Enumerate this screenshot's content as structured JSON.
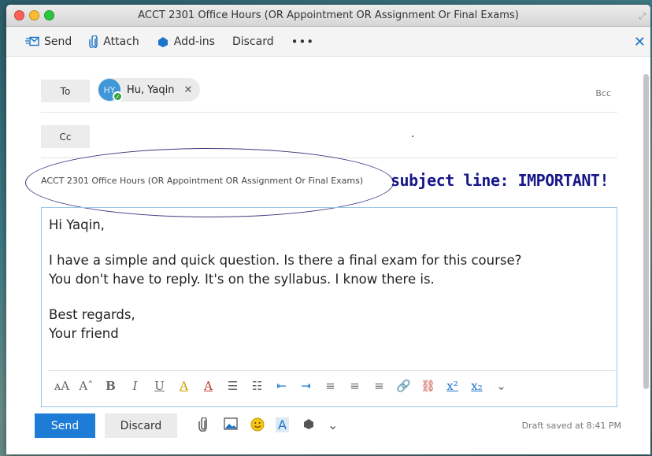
{
  "window": {
    "title": "ACCT 2301 Office Hours (OR Appointment OR Assignment Or Final Exams)"
  },
  "toolbar": {
    "send_label": "Send",
    "attach_label": "Attach",
    "addins_label": "Add-ins",
    "discard_label": "Discard",
    "more_label": "•••"
  },
  "recipients": {
    "to_label": "To",
    "cc_label": "Cc",
    "bcc_label": "Bcc",
    "to_chip": {
      "initials": "HY",
      "name": "Hu, Yaqin",
      "remove": "✕"
    },
    "cc_value": "."
  },
  "subject": {
    "value": "ACCT 2301 Office Hours (OR Appointment OR Assignment Or Final Exams)",
    "annotation": "subject line: IMPORTANT!"
  },
  "message": {
    "greeting": "Hi Yaqin,",
    "line1": "I have a simple and quick question. Is there a final exam for this course?",
    "line2": "You don't have to reply. It's on the syllabus. I know there is.",
    "closing": "Best regards,",
    "signature": "Your friend"
  },
  "format_bar": {
    "font_size": "ᴀA",
    "grow_font": "Aˆ",
    "bold": "B",
    "italic": "I",
    "underline": "U",
    "highlight": "A",
    "font_color": "A",
    "bullets": "☰",
    "numbering": "☷",
    "outdent": "⇤",
    "indent": "⇥",
    "align_left": "≡",
    "align_center": "≡",
    "align_right": "≡",
    "link": "🔗",
    "unlink": "⛓",
    "superscript": "x²",
    "subscript": "x₂",
    "more": "⌄"
  },
  "footer": {
    "send_label": "Send",
    "discard_label": "Discard",
    "draft_status": "Draft saved at 8:41 PM"
  },
  "colors": {
    "accent": "#1f7cd6",
    "annotation": "#17178a",
    "status_green": "#37a23f"
  }
}
